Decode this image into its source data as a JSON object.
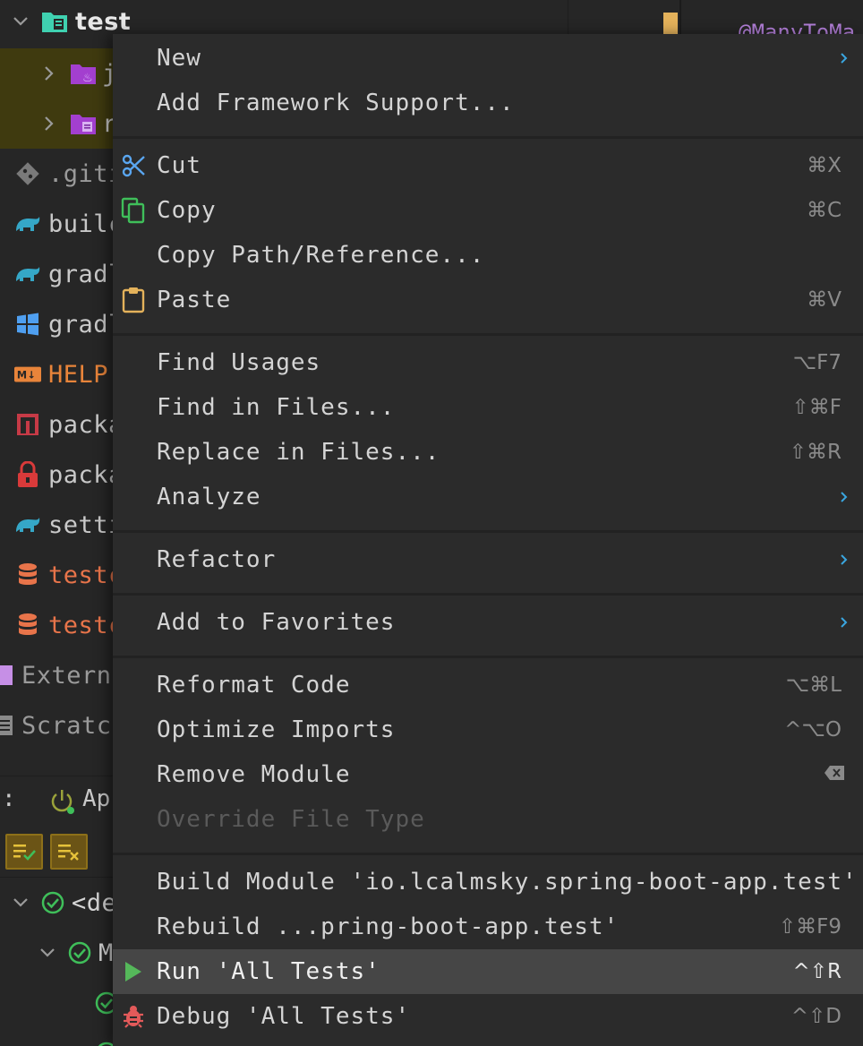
{
  "tree": {
    "root": "test",
    "child_java": "j",
    "child_resources": "r",
    "items": [
      ".giti",
      "builc",
      "gradl",
      "gradl",
      "HELP.",
      "packa",
      "packa",
      "setti",
      "testc",
      "testc",
      "Externa",
      "Scratch"
    ]
  },
  "run_panel": {
    "colon": ":",
    "tab_label": "Ap",
    "row1": "<de",
    "row2": "M"
  },
  "editor": {
    "annotation": "@ManyToMa"
  },
  "menu": {
    "new": "New",
    "add_framework": "Add Framework Support...",
    "cut": "Cut",
    "cut_key": "⌘X",
    "copy": "Copy",
    "copy_key": "⌘C",
    "copy_path": "Copy Path/Reference...",
    "paste": "Paste",
    "paste_key": "⌘V",
    "find_usages": "Find Usages",
    "find_usages_key": "⌥F7",
    "find_in_files": "Find in Files...",
    "find_in_files_key": "⇧⌘F",
    "replace_in_files": "Replace in Files...",
    "replace_in_files_key": "⇧⌘R",
    "analyze": "Analyze",
    "refactor": "Refactor",
    "add_to_favorites": "Add to Favorites",
    "reformat_code": "Reformat Code",
    "reformat_code_key": "⌥⌘L",
    "optimize_imports": "Optimize Imports",
    "optimize_imports_key": "^⌥O",
    "remove_module": "Remove Module",
    "override_file_type": "Override File Type",
    "build_module": "Build Module 'io.lcalmsky.spring-boot-app.test'",
    "rebuild": "Rebuild ...pring-boot-app.test'",
    "rebuild_key": "⇧⌘F9",
    "run_all_tests": "Run 'All Tests'",
    "run_all_tests_key": "^⇧R",
    "debug_all_tests": "Debug 'All Tests'",
    "debug_all_tests_key": "^⇧D"
  },
  "colors": {
    "menu_bg": "#2b2b2b",
    "highlight": "#464646",
    "submenu_arrow": "#3aa6e0",
    "selected_row": "#3f3a0f"
  }
}
